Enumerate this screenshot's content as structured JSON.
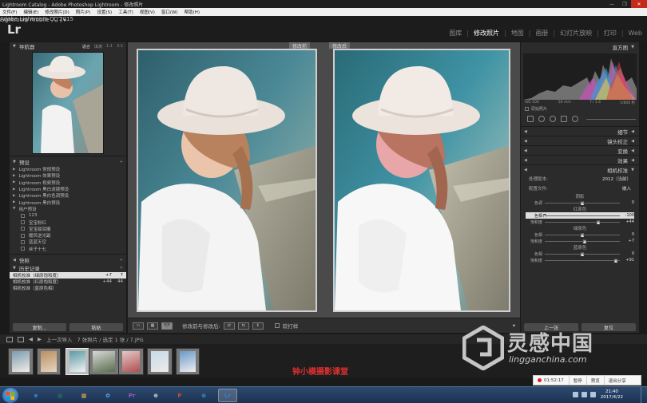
{
  "window": {
    "title": "Lightroom Catalog - Adobe Photoshop Lightroom - 修改照片"
  },
  "menu": [
    "文件(F)",
    "编辑(E)",
    "修改照片(D)",
    "照片(P)",
    "设置(S)",
    "工具(T)",
    "视图(V)",
    "窗口(W)",
    "帮助(H)"
  ],
  "identity": {
    "logo": "Lr",
    "brand": "Adobe Lightroom CC 2015",
    "mobile": "Lightroom mobile 入门 ▸"
  },
  "modules": {
    "items": [
      "图库",
      "修改照片",
      "地图",
      "画册",
      "幻灯片放映",
      "打印",
      "Web"
    ],
    "active": "修改照片"
  },
  "left": {
    "navigator": {
      "title": "导航器",
      "zoom": [
        "适合",
        "填满",
        "1:1",
        "3:1"
      ]
    },
    "presets": {
      "title": "预设",
      "items": [
        {
          "label": "Lightroom 常规预设",
          "type": "folder"
        },
        {
          "label": "Lightroom 效果预设",
          "type": "folder"
        },
        {
          "label": "Lightroom 视频预设",
          "type": "folder"
        },
        {
          "label": "Lightroom 黑白滤镜预设",
          "type": "folder"
        },
        {
          "label": "Lightroom 黑白色调预设",
          "type": "folder"
        },
        {
          "label": "Lightroom 黑白预设",
          "type": "folder"
        },
        {
          "label": "用户预设",
          "type": "open"
        },
        {
          "label": "123",
          "type": "item"
        },
        {
          "label": "宝宝粉红",
          "type": "item"
        },
        {
          "label": "宝宝甜润嫩",
          "type": "item"
        },
        {
          "label": "暖风逆光副",
          "type": "item"
        },
        {
          "label": "蓝蓝天空",
          "type": "item"
        },
        {
          "label": "丝子十七",
          "type": "item"
        }
      ]
    },
    "snapshots": {
      "title": "快照"
    },
    "history": {
      "title": "历史记录",
      "rows": [
        {
          "label": "相机校准（绿原饱和度）",
          "v1": "+7",
          "v2": "7"
        },
        {
          "label": "相机校准（红原饱和度）",
          "v1": "+44",
          "v2": "44"
        },
        {
          "label": "相机校准（蓝原色相）",
          "v1": "",
          "v2": ""
        }
      ]
    },
    "buttons": {
      "copy": "复制...",
      "paste": "粘贴"
    }
  },
  "center": {
    "before_label": "修改前",
    "after_label": "修改后",
    "toolbar": {
      "view_mode": "Y|Y",
      "copy_label": "修改前与修改后:",
      "softproof": "软打样"
    }
  },
  "right": {
    "histogram": {
      "title": "直方图",
      "iso": "ISO 100",
      "focal": "50 mm",
      "aperture": "f / 1.4",
      "shutter": "1/800 秒",
      "original": "原始照片"
    },
    "sections": [
      "细节",
      "镜头校正",
      "变换",
      "效果",
      "相机校准"
    ],
    "process": {
      "label": "处理版本:",
      "value": "2012（当前）"
    },
    "profile": {
      "label": "配置文件:",
      "value": "嵌入"
    },
    "groups": [
      {
        "title": "阴影",
        "sliders": [
          {
            "name": "色调",
            "value": "0",
            "pos": 0.5,
            "hl": false
          }
        ]
      },
      {
        "title": "红原色",
        "sliders": [
          {
            "name": "色相",
            "value": "-100",
            "pos": 0.0,
            "hl": true
          },
          {
            "name": "饱和度",
            "value": "+44",
            "pos": 0.72,
            "hl": false
          }
        ]
      },
      {
        "title": "绿原色",
        "sliders": [
          {
            "name": "色相",
            "value": "0",
            "pos": 0.5,
            "hl": false
          },
          {
            "name": "饱和度",
            "value": "+7",
            "pos": 0.54,
            "hl": false
          }
        ]
      },
      {
        "title": "蓝原色",
        "sliders": [
          {
            "name": "色相",
            "value": "0",
            "pos": 0.5,
            "hl": false
          },
          {
            "name": "饱和度",
            "value": "+91",
            "pos": 0.95,
            "hl": false
          }
        ]
      }
    ],
    "buttons": {
      "prev": "上一张",
      "reset": "复位"
    }
  },
  "filmstrip": {
    "nav": "上一次导入",
    "info": "7 张照片 / 选定 1 张 / 7.JPG"
  },
  "overlay": {
    "caption": "钟小模摄影课堂",
    "brand_cn": "灵感中国",
    "brand_url": "lingganchina.com"
  },
  "recorder": {
    "time": "01:52:17",
    "pause": "暂停",
    "preview": "预览",
    "exit": "退出分享"
  },
  "taskbar": {
    "time": "21:40",
    "date": "2017/4/22",
    "apps": [
      "e",
      "◎",
      "▦",
      "✿",
      "Pr",
      "⊕",
      "P",
      "⊙",
      "Lr"
    ]
  },
  "colors": {
    "accent": "#e03030",
    "panel": "#2b2b2b",
    "background": "#1a1a1a"
  }
}
